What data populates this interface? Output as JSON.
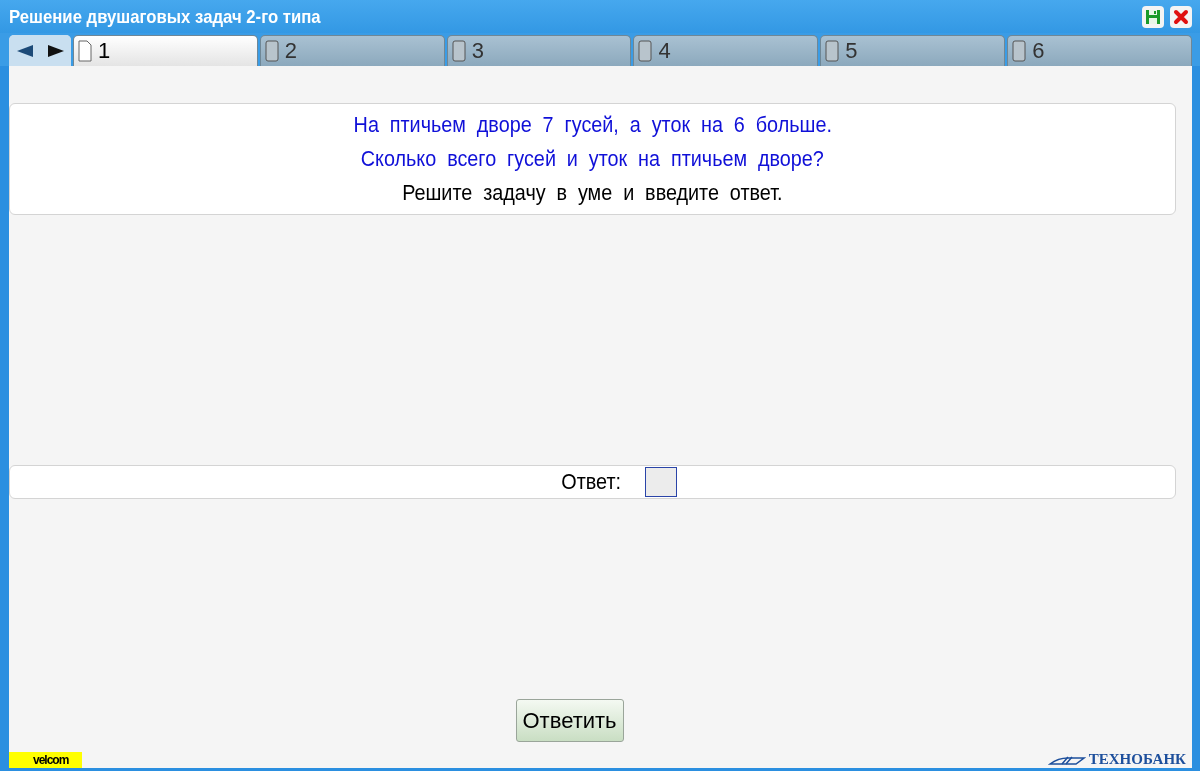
{
  "window": {
    "title": "Решение двушаговых задач 2-го типа"
  },
  "tabs": [
    {
      "label": "1",
      "selected": true
    },
    {
      "label": "2",
      "selected": false
    },
    {
      "label": "3",
      "selected": false
    },
    {
      "label": "4",
      "selected": false
    },
    {
      "label": "5",
      "selected": false
    },
    {
      "label": "6",
      "selected": false
    }
  ],
  "problem": [
    {
      "kind": "question",
      "text": "На птичьем дворе 7 гусей, а уток на 6 больше."
    },
    {
      "kind": "question",
      "text": "Сколько всего гусей и уток на птичьем дворе?"
    },
    {
      "kind": "instruction",
      "text": "Решите задачу в уме и введите ответ."
    }
  ],
  "answer": {
    "label": "Ответ:"
  },
  "submit_button": "Ответить",
  "footer": {
    "left_logo": "velcom",
    "right_logo": "ТЕХНОБАНК"
  }
}
